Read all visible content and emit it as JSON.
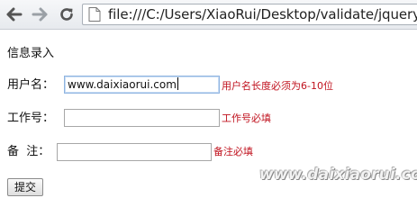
{
  "browser": {
    "url": "file:///C:/Users/XiaoRui/Desktop/validate/jquery",
    "icons": [
      "back-arrow-icon",
      "forward-arrow-icon",
      "reload-icon",
      "page-icon"
    ]
  },
  "form": {
    "title": "信息录入",
    "fields": [
      {
        "label": "用户名：",
        "value": "www.daixiaorui.com",
        "error": "用户名长度必须为6-10位"
      },
      {
        "label": "工作号：",
        "value": "",
        "error": "工作号必填"
      },
      {
        "label": "备  注：",
        "value": "",
        "error": "备注必填"
      }
    ],
    "submit_label": "提交"
  },
  "watermark": "www.daixiaorui.com",
  "colors": {
    "error": "#c0121e",
    "focus_border": "#8fb4e0"
  }
}
